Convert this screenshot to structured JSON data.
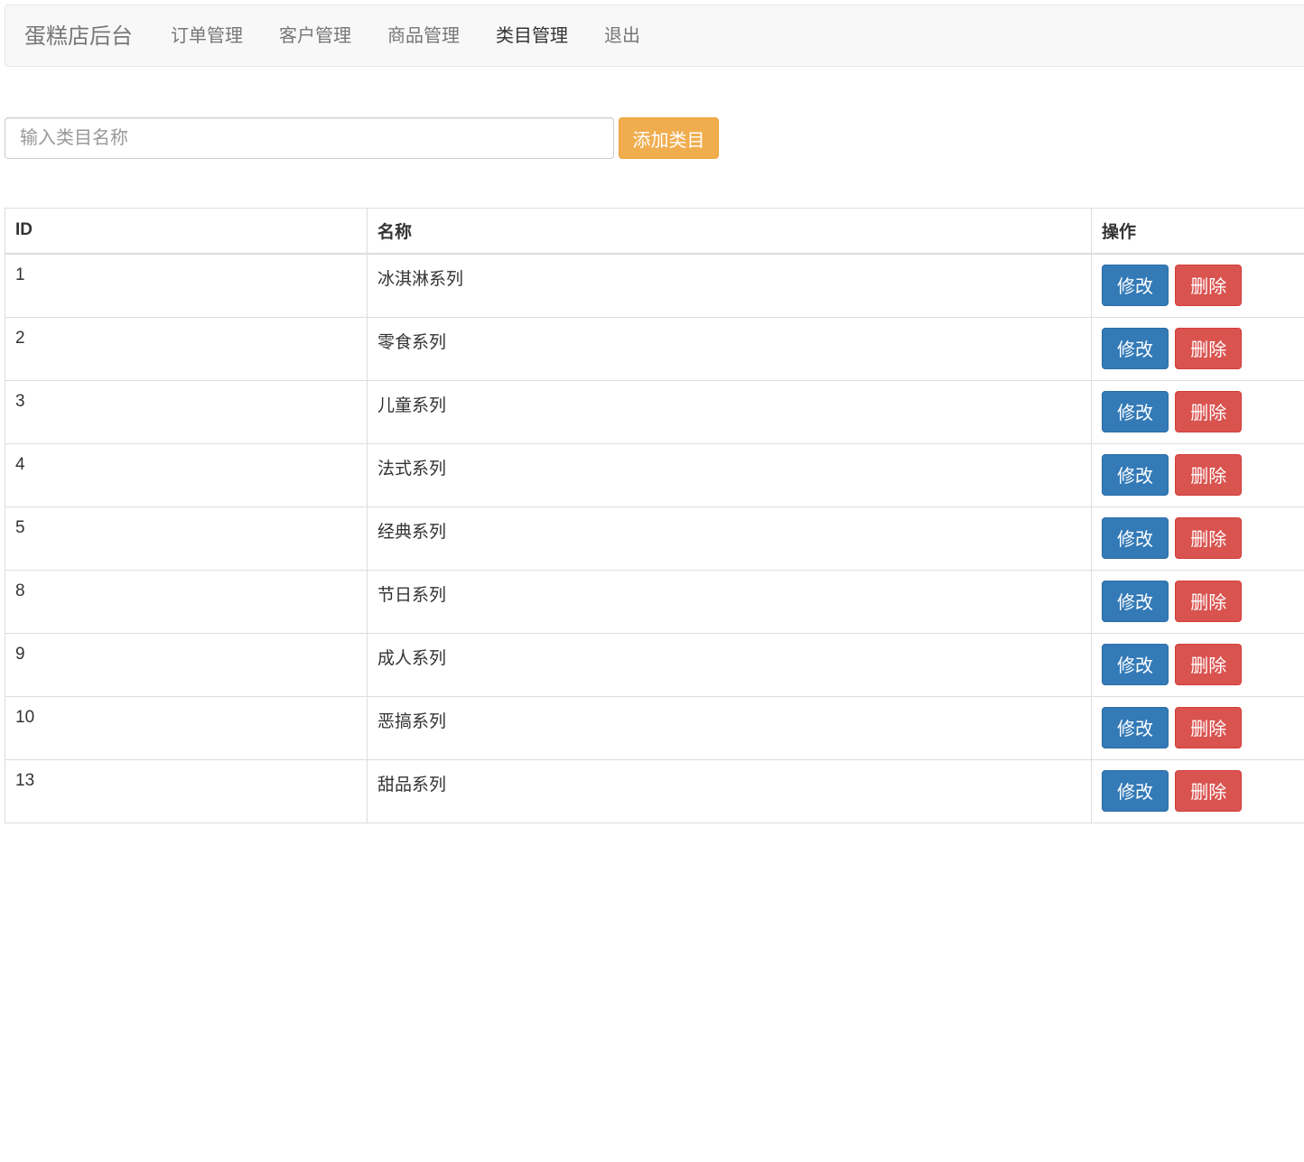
{
  "navbar": {
    "brand": "蛋糕店后台",
    "items": [
      {
        "label": "订单管理",
        "active": false
      },
      {
        "label": "客户管理",
        "active": false
      },
      {
        "label": "商品管理",
        "active": false
      },
      {
        "label": "类目管理",
        "active": true
      },
      {
        "label": "退出",
        "active": false
      }
    ]
  },
  "form": {
    "placeholder": "输入类目名称",
    "value": "",
    "add_label": "添加类目"
  },
  "table": {
    "headers": {
      "id": "ID",
      "name": "名称",
      "ops": "操作"
    },
    "edit_label": "修改",
    "delete_label": "删除",
    "rows": [
      {
        "id": "1",
        "name": "冰淇淋系列"
      },
      {
        "id": "2",
        "name": "零食系列"
      },
      {
        "id": "3",
        "name": "儿童系列"
      },
      {
        "id": "4",
        "name": "法式系列"
      },
      {
        "id": "5",
        "name": "经典系列"
      },
      {
        "id": "8",
        "name": "节日系列"
      },
      {
        "id": "9",
        "name": "成人系列"
      },
      {
        "id": "10",
        "name": "恶搞系列"
      },
      {
        "id": "13",
        "name": "甜品系列"
      }
    ]
  },
  "colors": {
    "navbar_bg": "#f8f8f8",
    "primary": "#337ab7",
    "danger": "#d9534f",
    "warning": "#f0ad4e"
  }
}
